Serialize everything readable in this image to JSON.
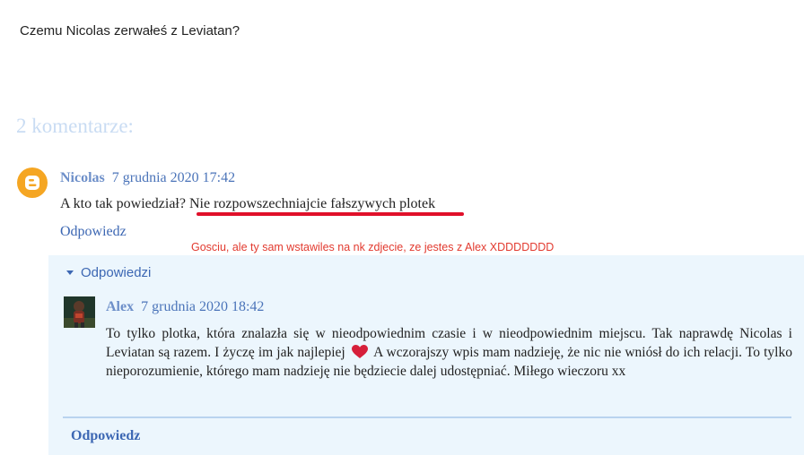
{
  "post": {
    "text": "Czemu Nicolas zerwałeś z Leviatan?"
  },
  "comments_heading": "2 komentarze:",
  "comment1": {
    "author": "Nicolas",
    "date": "7 grudnia 2020 17:42",
    "text_part1": "A kto tak powiedział? ",
    "text_part2": "Nie rozpowszechniajcie fałszywych plotek",
    "reply_label": "Odpowiedz"
  },
  "annotation": "Gosciu, ale ty sam wstawiles na nk zdjecie, ze jestes z Alex XDDDDDDD",
  "thread": {
    "toggle_label": "Odpowiedzi",
    "reply": {
      "author": "Alex",
      "date": "7 grudnia 2020 18:42",
      "text_before_heart": "To tylko plotka, która znalazła się w nieodpowiednim czasie i w nieodpowiednim miejscu. Tak naprawdę Nicolas i Leviatan są razem. I życzę im jak najlepiej",
      "text_after_heart": "A wczorajszy wpis mam nadzieję, że nic nie wniósł do ich relacji. To tylko nieporozumienie, którego mam nadzieję nie będziecie dalej udostępniać. Miłego wieczoru xx"
    },
    "reply_label": "Odpowiedz"
  },
  "colors": {
    "link": "#3c67b3",
    "annotation": "#e23a2f",
    "thread_bg": "#ecf6fd",
    "blogger_orange": "#f5a623"
  },
  "icons": [
    "blogger-avatar-icon",
    "caret-down-icon",
    "heart-icon",
    "user-avatar"
  ]
}
